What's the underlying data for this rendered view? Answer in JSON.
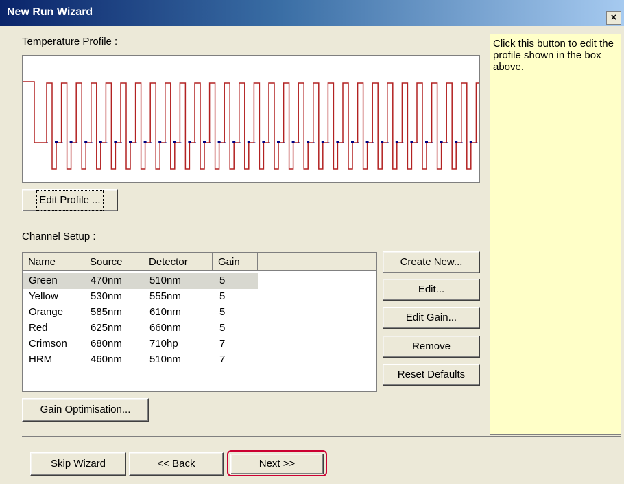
{
  "window": {
    "title": "New Run Wizard",
    "close_label": "×"
  },
  "profile": {
    "label": "Temperature Profile :",
    "cycles": 30
  },
  "edit_profile_button": "Edit Profile ...",
  "channel_setup": {
    "label": "Channel Setup :",
    "columns": [
      "Name",
      "Source",
      "Detector",
      "Gain"
    ],
    "rows": [
      {
        "name": "Green",
        "source": "470nm",
        "detector": "510nm",
        "gain": "5"
      },
      {
        "name": "Yellow",
        "source": "530nm",
        "detector": "555nm",
        "gain": "5"
      },
      {
        "name": "Orange",
        "source": "585nm",
        "detector": "610nm",
        "gain": "5"
      },
      {
        "name": "Red",
        "source": "625nm",
        "detector": "660nm",
        "gain": "5"
      },
      {
        "name": "Crimson",
        "source": "680nm",
        "detector": "710hp",
        "gain": "7"
      },
      {
        "name": "HRM",
        "source": "460nm",
        "detector": "510nm",
        "gain": "7"
      }
    ],
    "selected_row": 0
  },
  "side_buttons": {
    "create_new": "Create New...",
    "edit": "Edit...",
    "edit_gain": "Edit Gain...",
    "remove": "Remove",
    "reset_defaults": "Reset Defaults"
  },
  "gain_optimisation_button": "Gain Optimisation...",
  "help_text": "Click this button to edit the profile shown in the box above.",
  "footer": {
    "skip": "Skip Wizard",
    "back": "<< Back",
    "next": "Next >>"
  },
  "colors": {
    "profile_line": "#b22222",
    "profile_marker": "#000080",
    "help_bg": "#ffffc8",
    "next_highlight": "#cc0033"
  }
}
